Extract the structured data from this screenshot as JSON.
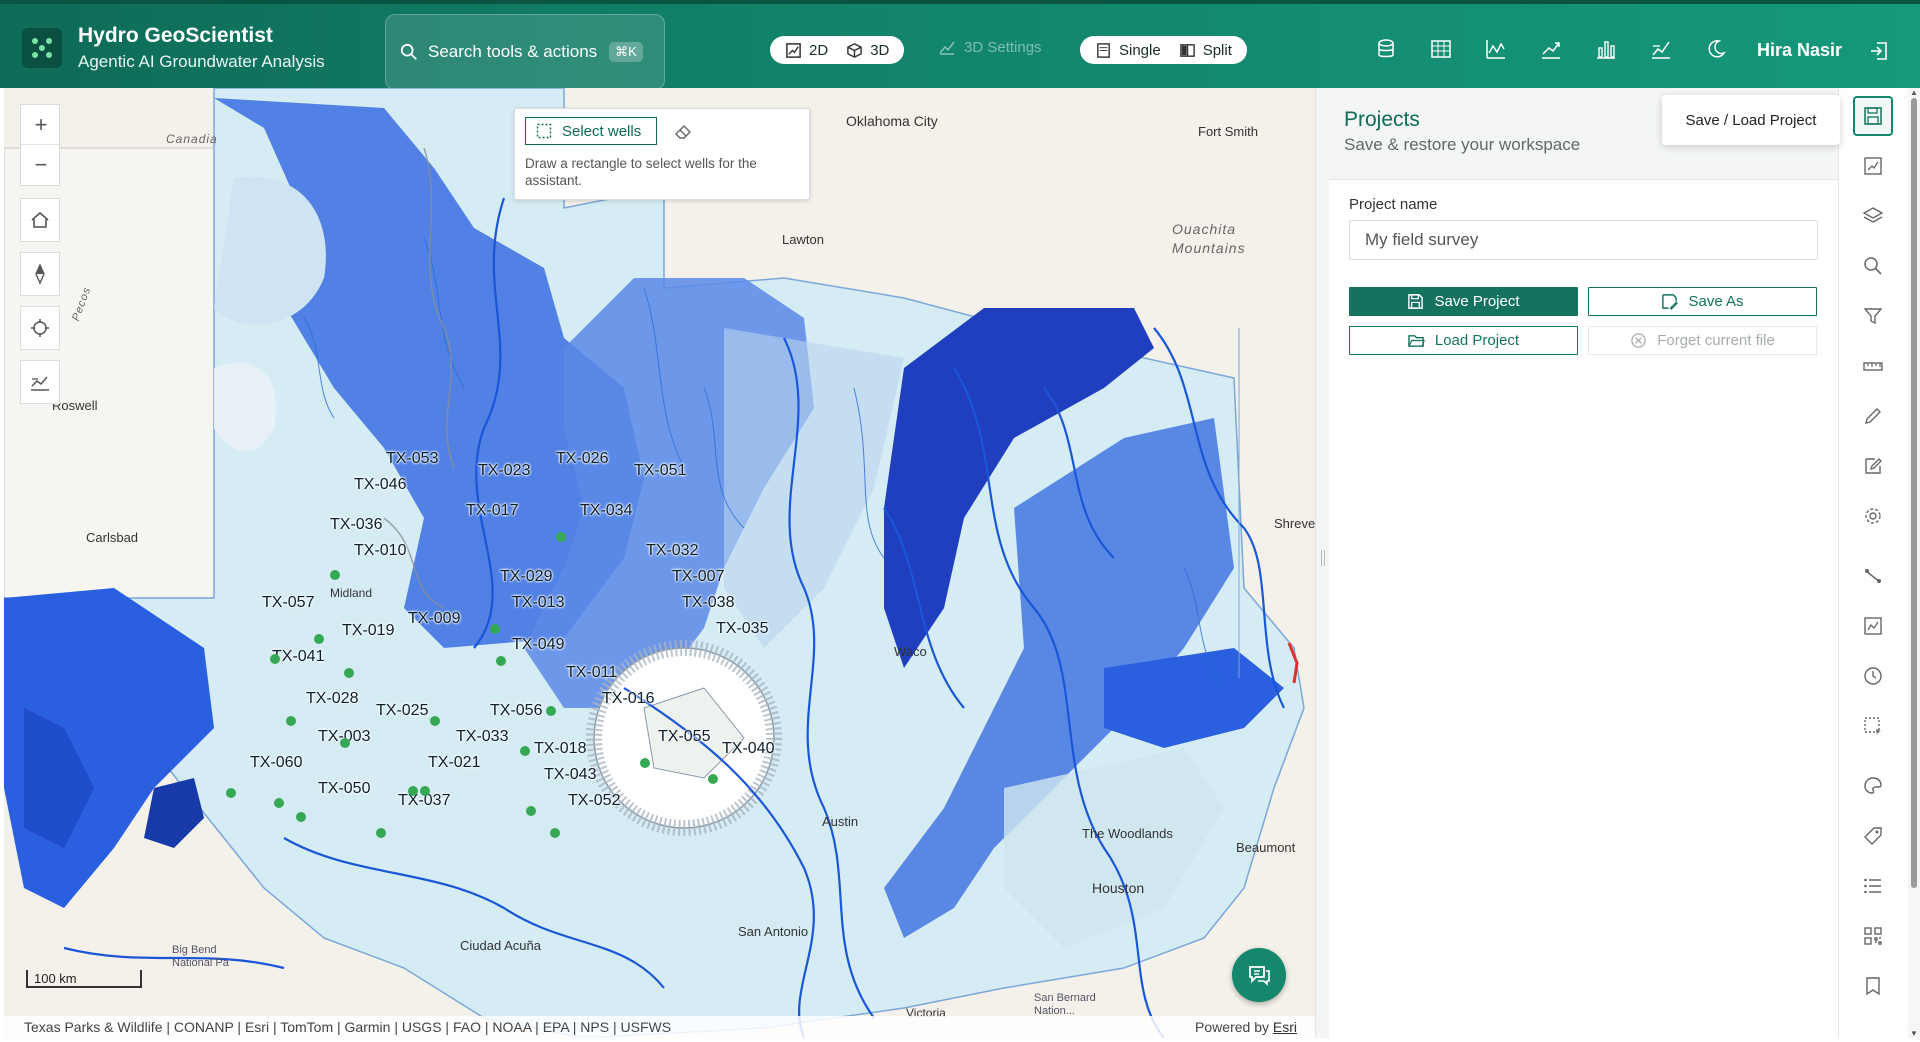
{
  "header": {
    "title": "Hydro GeoScientist",
    "subtitle": "Agentic AI Groundwater Analysis",
    "search_placeholder": "Search tools & actions",
    "search_shortcut": "⌘K",
    "view_2d": "2D",
    "view_3d": "3D",
    "settings_3d": "3D Settings",
    "layout_single": "Single",
    "layout_split": "Split",
    "user_name": "Hira Nasir",
    "icons": [
      "database-icon",
      "table-icon",
      "line-chart-icon",
      "trend-chart-icon",
      "bar-chart-icon",
      "scatter-chart-icon",
      "moon-icon"
    ]
  },
  "map": {
    "select_wells_label": "Select wells",
    "select_hint": "Draw a rectangle to select wells for the assistant.",
    "scale_label": "100 km",
    "attribution": "Texas Parks & Wildlife | CONANP | Esri | TomTom | Garmin | USGS | FAO | NOAA | EPA | NPS | USFWS",
    "powered_prefix": "Powered by ",
    "powered_link": "Esri",
    "places": [
      {
        "id": "oklahoma",
        "name": "Oklahoma City"
      },
      {
        "id": "fortsmith",
        "name": "Fort Smith"
      },
      {
        "id": "lawton",
        "name": "Lawton"
      },
      {
        "id": "ouachita",
        "name": "Ouachita\nMountains"
      },
      {
        "id": "roswell",
        "name": "Roswell"
      },
      {
        "id": "carlsbad",
        "name": "Carlsbad"
      },
      {
        "id": "shreve",
        "name": "Shreve"
      },
      {
        "id": "waco",
        "name": "Waco"
      },
      {
        "id": "austin",
        "name": "Austin"
      },
      {
        "id": "woodlands",
        "name": "The Woodlands"
      },
      {
        "id": "houston",
        "name": "Houston"
      },
      {
        "id": "beaumont",
        "name": "Beaumont"
      },
      {
        "id": "sanantonio",
        "name": "San Antonio"
      },
      {
        "id": "ciudad",
        "name": "Ciudad Acuña"
      },
      {
        "id": "bigbend",
        "name": "Big Bend\nNational Pa"
      },
      {
        "id": "midland",
        "name": "Midland"
      },
      {
        "id": "victoria",
        "name": "Victoria"
      },
      {
        "id": "sanbern",
        "name": "San Bernard\nNation..."
      },
      {
        "id": "canadian",
        "name": "Canadia"
      },
      {
        "id": "pecos",
        "name": "Pecos"
      }
    ],
    "wells": [
      "TX-053",
      "TX-023",
      "TX-026",
      "TX-051",
      "TX-046",
      "TX-017",
      "TX-034",
      "TX-036",
      "TX-010",
      "TX-032",
      "TX-029",
      "TX-007",
      "TX-057",
      "TX-013",
      "TX-038",
      "TX-009",
      "TX-019",
      "TX-035",
      "TX-049",
      "TX-041",
      "TX-011",
      "TX-016",
      "TX-028",
      "TX-025",
      "TX-056",
      "TX-055",
      "TX-003",
      "TX-033",
      "TX-018",
      "TX-040",
      "TX-060",
      "TX-021",
      "TX-043",
      "TX-050",
      "TX-037",
      "TX-052"
    ]
  },
  "panel": {
    "title": "Projects",
    "subtitle": "Save & restore your workspace",
    "tooltip": "Save / Load Project",
    "project_name_label": "Project name",
    "project_name_value": "My field survey",
    "save_project": "Save Project",
    "save_as": "Save As",
    "load_project": "Load Project",
    "forget_file": "Forget current file"
  },
  "rail": {
    "icons": [
      "save-load-project-icon",
      "map-draw-icon",
      "layers-icon",
      "search-icon",
      "filter-icon",
      "measure-icon",
      "pencil-icon",
      "edit-note-icon",
      "settings-icon",
      "profile-line-icon",
      "chart-frame-icon",
      "history-icon",
      "select-area-icon",
      "palette-icon",
      "label-icon",
      "list-icon",
      "qr-grid-icon",
      "bookmark-icon"
    ]
  },
  "colors": {
    "brand": "#14876c",
    "brand_dark": "#0e6b58",
    "aquifer_dark": "#1d4fd6",
    "aquifer_light": "#cfe6f2",
    "well_dot": "#34a853"
  }
}
